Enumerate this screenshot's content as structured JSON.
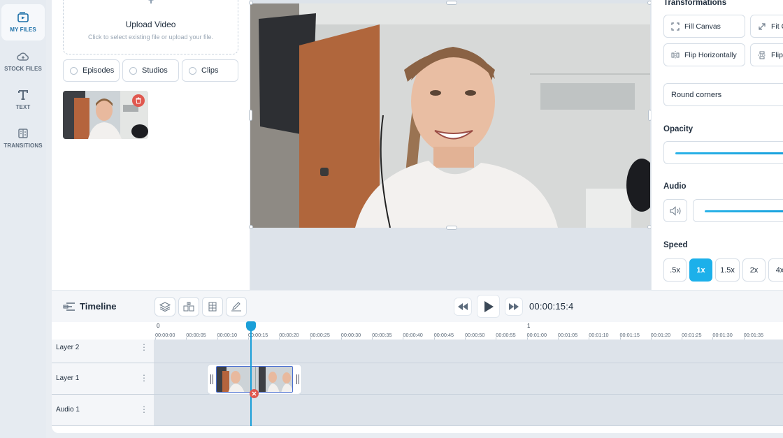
{
  "nav": {
    "items": [
      {
        "label": "MY FILES"
      },
      {
        "label": "STOCK FILES"
      },
      {
        "label": "TEXT"
      },
      {
        "label": "TRANSITIONS"
      }
    ]
  },
  "files": {
    "upload_title": "Upload Video",
    "upload_sub": "Click to select existing file or upload your file.",
    "filters": [
      "Episodes",
      "Studios",
      "Clips"
    ]
  },
  "properties": {
    "transformations_title": "Transformations",
    "fill_canvas": "Fill Canvas",
    "fit_canvas": "Fit C",
    "flip_horizontally": "Flip Horizontally",
    "flip_vertically": "Flip",
    "round_corners": "Round corners",
    "opacity_title": "Opacity",
    "audio_title": "Audio",
    "speed_title": "Speed",
    "speeds": [
      ".5x",
      "1x",
      "1.5x",
      "2x",
      "4x"
    ],
    "active_speed": "1x"
  },
  "timeline": {
    "title": "Timeline",
    "timecode": "00:00:15:4",
    "second_markers": [
      "0",
      "1"
    ],
    "ticks": [
      "00:00:00",
      "00:00:05",
      "00:00:10",
      "00:00:15",
      "00:00:20",
      "00:00:25",
      "00:00:30",
      "00:00:35",
      "00:00:40",
      "00:00:45",
      "00:00:50",
      "00:00:55",
      "00:01:00",
      "00:01:05",
      "00:01:10",
      "00:01:15",
      "00:01:20",
      "00:01:25",
      "00:01:30",
      "00:01:35"
    ],
    "layers": [
      "Layer 2",
      "Layer 1",
      "Audio 1"
    ]
  },
  "colors": {
    "accent": "#1cb0ea",
    "danger": "#e0584f",
    "playhead": "#1a9fd8"
  }
}
